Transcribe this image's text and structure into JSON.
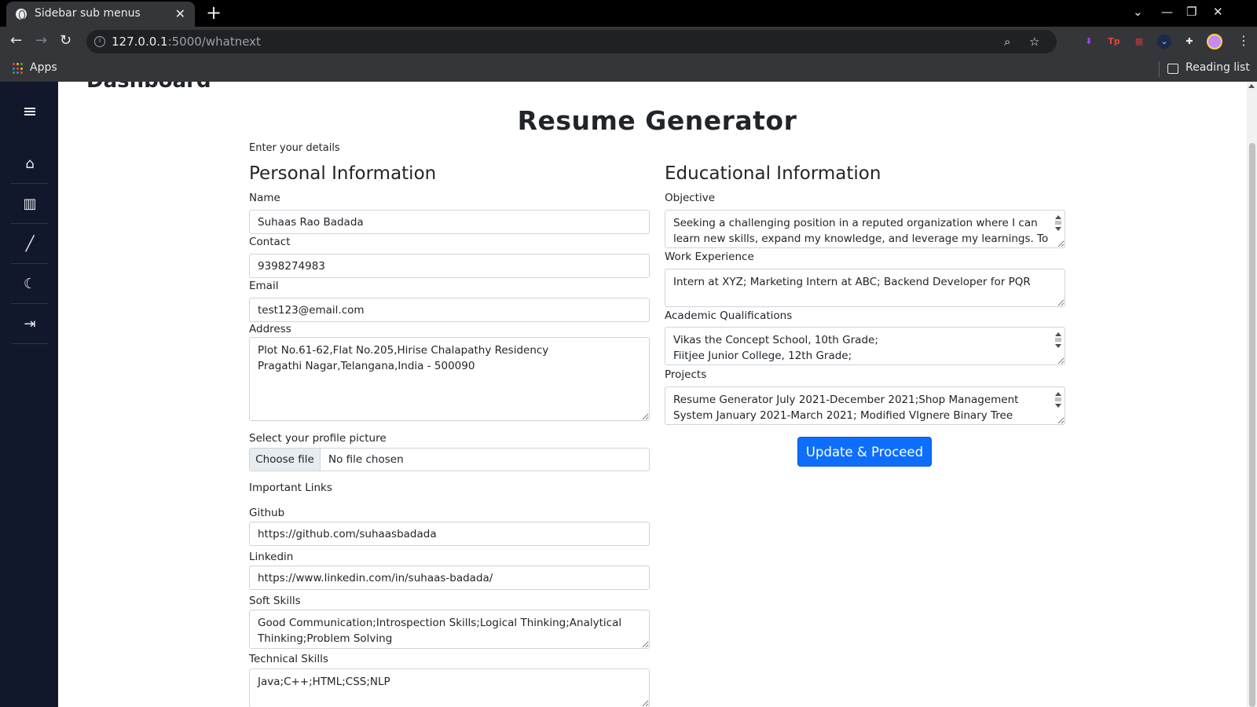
{
  "browser": {
    "tab_title": "Sidebar sub menus",
    "tab_close": "✕",
    "new_tab": "+",
    "url_host": "127.0.0.1",
    "url_path": ":5000/whatnext",
    "bookmarks": {
      "apps_label": "Apps",
      "reading_list_label": "Reading list"
    },
    "controls": {
      "back": "←",
      "forward": "→",
      "reload": "↻",
      "zoom": "⌕",
      "star": "☆",
      "tab_search": "⌄",
      "minimize": "—",
      "restore": "❐",
      "close": "✕",
      "menu": "⋮"
    },
    "extensions": [
      {
        "name": "download-extension-icon",
        "glyph": "⬇",
        "color": "#a142f4"
      },
      {
        "name": "tp-extension-icon",
        "glyph": "Tp",
        "color": "#ea4335"
      },
      {
        "name": "red-extension-icon",
        "glyph": "▦",
        "color": "#d93025"
      },
      {
        "name": "dropdown-extension-icon",
        "glyph": "⌄",
        "color": "#8ab4f8"
      },
      {
        "name": "puzzle-extension-icon",
        "glyph": "✚",
        "color": "#e8eaed"
      }
    ]
  },
  "sidebar": {
    "heading_clipped": "Dashboard",
    "items": [
      {
        "name": "home",
        "glyph": "⌂"
      },
      {
        "name": "library",
        "glyph": "▥"
      },
      {
        "name": "pen",
        "glyph": "╱"
      },
      {
        "name": "moon",
        "glyph": "☾"
      },
      {
        "name": "logout",
        "glyph": "⇥"
      }
    ]
  },
  "page": {
    "title": "Resume Generator",
    "subtitle": "Enter your details",
    "personal": {
      "heading": "Personal Information",
      "name_label": "Name",
      "name_value": "Suhaas Rao Badada",
      "contact_label": "Contact",
      "contact_value": "9398274983",
      "email_label": "Email",
      "email_value": "test123@email.com",
      "address_label": "Address",
      "address_value": "Plot No.61-62,Flat No.205,Hirise Chalapathy Residency\nPragathi Nagar,Telangana,India - 500090",
      "picture_label": "Select your profile picture",
      "file_button": "Choose file",
      "file_status": "No file chosen",
      "links_heading": "Important Links",
      "github_label": "Github",
      "github_value": "https://github.com/suhaasbadada",
      "linkedin_label": "Linkedin",
      "linkedin_value": "https://www.linkedin.com/in/suhaas-badada/",
      "soft_skills_label": "Soft Skills",
      "soft_skills_value": "Good Communication;Introspection Skills;Logical Thinking;Analytical Thinking;Problem Solving",
      "tech_skills_label": "Technical Skills",
      "tech_skills_value": "Java;C++;HTML;CSS;NLP"
    },
    "educational": {
      "heading": "Educational Information",
      "objective_label": "Objective",
      "objective_value": "Seeking a challenging position in a reputed organization where I can learn new skills, expand my knowledge, and leverage my learnings. To",
      "work_label": "Work Experience",
      "work_value": "Intern at XYZ; Marketing Intern at ABC; Backend Developer for PQR",
      "academic_label": "Academic Qualifications",
      "academic_value": "Vikas the Concept School, 10th Grade;\nFiitjee Junior College, 12th Grade;",
      "projects_label": "Projects",
      "projects_value": "Resume Generator July 2021-December 2021;Shop Management System January 2021-March 2021; Modified VIgnere Binary Tree Encryption July",
      "submit_label": "Update & Proceed"
    }
  },
  "colors": {
    "sidebar_bg": "#11182b",
    "primary": "#0d6efd",
    "chrome_dark": "#35363a"
  }
}
